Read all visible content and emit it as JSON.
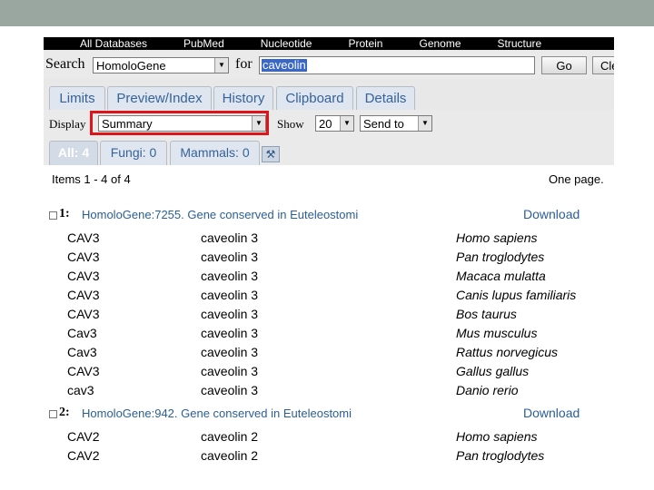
{
  "nav": [
    "All Databases",
    "PubMed",
    "Nucleotide",
    "Protein",
    "Genome",
    "Structure"
  ],
  "search": {
    "label": "Search",
    "database": "HomoloGene",
    "for_label": "for",
    "term": "caveolin",
    "go_label": "Go",
    "clear_label": "Cle"
  },
  "tabs": [
    "Limits",
    "Preview/Index",
    "History",
    "Clipboard",
    "Details"
  ],
  "display": {
    "label": "Display",
    "format": "Summary",
    "show_label": "Show",
    "count": "20",
    "send_to": "Send to"
  },
  "filters": [
    "All: 4",
    "Fungi: 0",
    "Mammals: 0"
  ],
  "results": {
    "items_text": "Items 1 - 4 of 4",
    "pages_text": "One page.",
    "records": [
      {
        "number": "1:",
        "title": "HomoloGene:7255. Gene conserved in Euteleostomi",
        "download": "Download",
        "genes": [
          {
            "symbol": "CAV3",
            "description": "caveolin 3",
            "organism": "Homo sapiens"
          },
          {
            "symbol": "CAV3",
            "description": "caveolin 3",
            "organism": "Pan troglodytes"
          },
          {
            "symbol": "CAV3",
            "description": "caveolin 3",
            "organism": "Macaca mulatta"
          },
          {
            "symbol": "CAV3",
            "description": "caveolin 3",
            "organism": "Canis lupus familiaris"
          },
          {
            "symbol": "CAV3",
            "description": "caveolin 3",
            "organism": "Bos taurus"
          },
          {
            "symbol": "Cav3",
            "description": "caveolin 3",
            "organism": "Mus musculus"
          },
          {
            "symbol": "Cav3",
            "description": "caveolin 3",
            "organism": "Rattus norvegicus"
          },
          {
            "symbol": "CAV3",
            "description": "caveolin 3",
            "organism": "Gallus gallus"
          },
          {
            "symbol": "cav3",
            "description": "caveolin 3",
            "organism": "Danio rerio"
          }
        ]
      },
      {
        "number": "2:",
        "title": "HomoloGene:942. Gene conserved in Euteleostomi",
        "download": "Download",
        "genes": [
          {
            "symbol": "CAV2",
            "description": "caveolin 2",
            "organism": "Homo sapiens"
          },
          {
            "symbol": "CAV2",
            "description": "caveolin 2",
            "organism": "Pan troglodytes"
          }
        ]
      }
    ]
  },
  "icons": {
    "select_arrow": "dropdown-arrow-icon",
    "tools": "tools-icon"
  },
  "colors": {
    "link": "#2a5e98",
    "highlight": "#e0131b",
    "topbar": "#9aa7a0"
  }
}
